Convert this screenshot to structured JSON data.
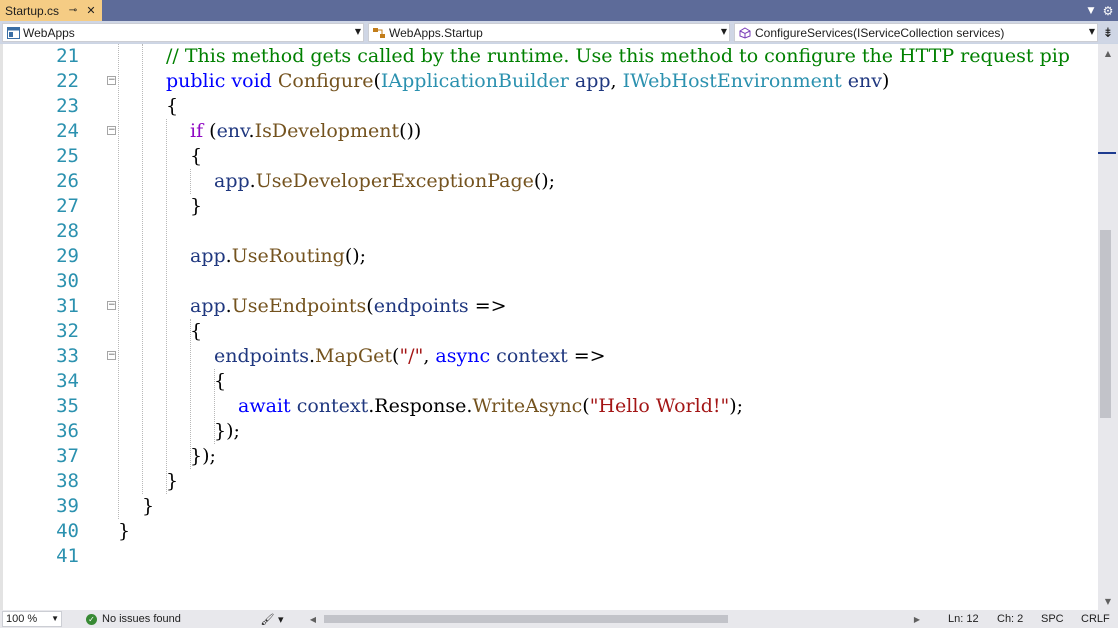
{
  "tab": {
    "title": "Startup.cs",
    "pin_glyph": "⊸",
    "close_glyph": "✕"
  },
  "navbar": {
    "project": "WebApps",
    "type": "WebApps.Startup",
    "member": "ConfigureServices(IServiceCollection services)"
  },
  "editor": {
    "lines": [
      {
        "n": "21",
        "tokens": [
          {
            "c": "cm",
            "t": "// This method gets called by the runtime. Use this method to configure the HTTP request pip"
          }
        ]
      },
      {
        "n": "22",
        "tokens": [
          {
            "c": "kw",
            "t": "public"
          },
          {
            "c": "",
            "t": " "
          },
          {
            "c": "kw",
            "t": "void"
          },
          {
            "c": "",
            "t": " "
          },
          {
            "c": "mt",
            "t": "Configure"
          },
          {
            "c": "",
            "t": "("
          },
          {
            "c": "ty",
            "t": "IApplicationBuilder"
          },
          {
            "c": "",
            "t": " "
          },
          {
            "c": "pr",
            "t": "app"
          },
          {
            "c": "",
            "t": ", "
          },
          {
            "c": "ty",
            "t": "IWebHostEnvironment"
          },
          {
            "c": "",
            "t": " "
          },
          {
            "c": "pr",
            "t": "env"
          },
          {
            "c": "",
            "t": ")"
          }
        ]
      },
      {
        "n": "23",
        "tokens": [
          {
            "c": "",
            "t": "{"
          }
        ]
      },
      {
        "n": "24",
        "tokens": [
          {
            "c": "ctl",
            "t": "if"
          },
          {
            "c": "",
            "t": " ("
          },
          {
            "c": "pr",
            "t": "env"
          },
          {
            "c": "",
            "t": "."
          },
          {
            "c": "mt",
            "t": "IsDevelopment"
          },
          {
            "c": "",
            "t": "())"
          }
        ]
      },
      {
        "n": "25",
        "tokens": [
          {
            "c": "",
            "t": "{"
          }
        ]
      },
      {
        "n": "26",
        "tokens": [
          {
            "c": "pr",
            "t": "app"
          },
          {
            "c": "",
            "t": "."
          },
          {
            "c": "mt",
            "t": "UseDeveloperExceptionPage"
          },
          {
            "c": "",
            "t": "();"
          }
        ]
      },
      {
        "n": "27",
        "tokens": [
          {
            "c": "",
            "t": "}"
          }
        ]
      },
      {
        "n": "28",
        "tokens": []
      },
      {
        "n": "29",
        "tokens": [
          {
            "c": "pr",
            "t": "app"
          },
          {
            "c": "",
            "t": "."
          },
          {
            "c": "mt",
            "t": "UseRouting"
          },
          {
            "c": "",
            "t": "();"
          }
        ]
      },
      {
        "n": "30",
        "tokens": []
      },
      {
        "n": "31",
        "tokens": [
          {
            "c": "pr",
            "t": "app"
          },
          {
            "c": "",
            "t": "."
          },
          {
            "c": "mt",
            "t": "UseEndpoints"
          },
          {
            "c": "",
            "t": "("
          },
          {
            "c": "pr",
            "t": "endpoints"
          },
          {
            "c": "",
            "t": " =>"
          }
        ]
      },
      {
        "n": "32",
        "tokens": [
          {
            "c": "",
            "t": "{"
          }
        ]
      },
      {
        "n": "33",
        "tokens": [
          {
            "c": "pr",
            "t": "endpoints"
          },
          {
            "c": "",
            "t": "."
          },
          {
            "c": "mt",
            "t": "MapGet"
          },
          {
            "c": "",
            "t": "("
          },
          {
            "c": "st",
            "t": "\"/\""
          },
          {
            "c": "",
            "t": ", "
          },
          {
            "c": "kw",
            "t": "async"
          },
          {
            "c": "",
            "t": " "
          },
          {
            "c": "pr",
            "t": "context"
          },
          {
            "c": "",
            "t": " =>"
          }
        ]
      },
      {
        "n": "34",
        "tokens": [
          {
            "c": "",
            "t": "{"
          }
        ]
      },
      {
        "n": "35",
        "tokens": [
          {
            "c": "kw",
            "t": "await"
          },
          {
            "c": "",
            "t": " "
          },
          {
            "c": "pr",
            "t": "context"
          },
          {
            "c": "",
            "t": ".Response."
          },
          {
            "c": "mt",
            "t": "WriteAsync"
          },
          {
            "c": "",
            "t": "("
          },
          {
            "c": "st",
            "t": "\"Hello World!\""
          },
          {
            "c": "",
            "t": ");"
          }
        ]
      },
      {
        "n": "36",
        "tokens": [
          {
            "c": "",
            "t": "});"
          }
        ]
      },
      {
        "n": "37",
        "tokens": [
          {
            "c": "",
            "t": "});"
          }
        ]
      },
      {
        "n": "38",
        "tokens": [
          {
            "c": "",
            "t": "}"
          }
        ]
      },
      {
        "n": "39",
        "tokens": [
          {
            "c": "",
            "t": "}"
          }
        ]
      },
      {
        "n": "40",
        "tokens": [
          {
            "c": "",
            "t": "}"
          }
        ]
      },
      {
        "n": "41",
        "tokens": []
      }
    ]
  },
  "statusbar": {
    "zoom": "100 %",
    "issues": "No issues found",
    "line": "Ln: 12",
    "col": "Ch: 2",
    "whitespace": "SPC",
    "line_ending": "CRLF"
  },
  "colors": {
    "tab_active": "#f5cc84",
    "tabstrip": "#5d6b99",
    "keyword": "#0000ff",
    "control_keyword": "#8f08c4",
    "comment": "#008000",
    "type": "#2b91af",
    "method": "#74531f",
    "parameter": "#1f377f",
    "string": "#a31515",
    "line_number": "#2b91af"
  },
  "icons": [
    "pin-icon",
    "close-icon",
    "tab-dropdown-icon",
    "settings-icon",
    "project-icon",
    "class-icon",
    "method-icon",
    "split-editor-icon",
    "check-icon",
    "code-cleanup-icon",
    "size-grip-icon"
  ]
}
